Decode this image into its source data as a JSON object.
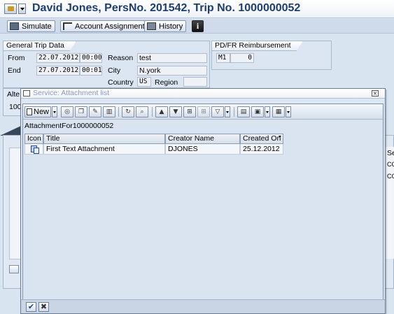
{
  "window": {
    "title": "David Jones, PersNo. 201542, Trip No. 1000000052"
  },
  "toolbar": {
    "simulate_label": "Simulate",
    "account_assignment_label": "Account Assignment",
    "history_label": "History",
    "info_label": "i"
  },
  "general_trip": {
    "header": "General Trip Data",
    "from_label": "From",
    "from_date": "22.07.2012",
    "from_time": "00:00",
    "end_label": "End",
    "end_date": "27.07.2012",
    "end_time": "00:01",
    "reason_label": "Reason",
    "reason_value": "test",
    "city_label": "City",
    "city_value": "N.york",
    "country_label": "Country",
    "country_value": "US",
    "region_label": "Region",
    "region_value": ""
  },
  "pdfr": {
    "header": "PD/FR Reimbursement",
    "code": "M1",
    "value": "0"
  },
  "background": {
    "alte_label": "Alte",
    "hundred_label": "100",
    "se_label": "Se",
    "co1": "CO",
    "co2": "CO"
  },
  "dialog": {
    "title": "Service: Attachment list",
    "close_glyph": "×",
    "new_label": "New",
    "heading": "AttachmentFor1000000052",
    "columns": {
      "icon": "Icon",
      "title": "Title",
      "creator": "Creator Name",
      "created_on": "Created On"
    },
    "rows": [
      {
        "icon": "document-icon",
        "title": "First Text Attachment",
        "creator": "DJONES",
        "created_on": "25.12.2012"
      }
    ],
    "ok_glyph": "✔",
    "cancel_glyph": "✖"
  },
  "colors": {
    "title_text": "#1f3e6b",
    "background": "#d9e4f1",
    "dialog_bg": "#dde7f3"
  }
}
